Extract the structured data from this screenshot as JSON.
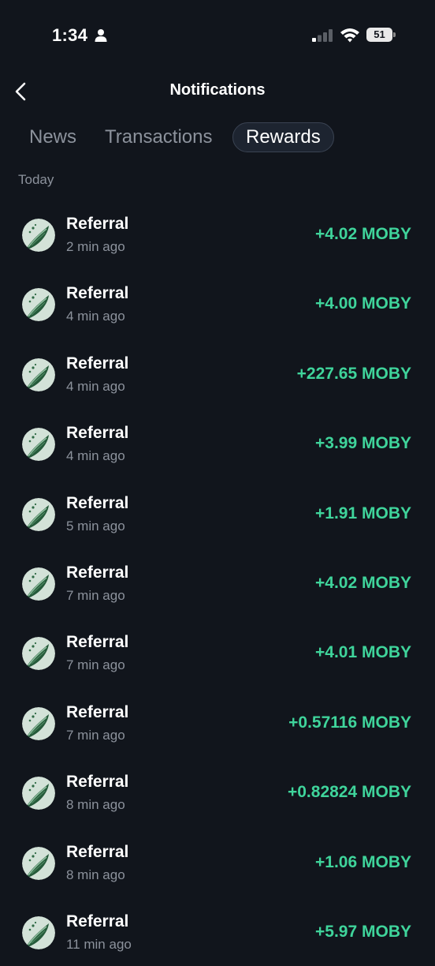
{
  "status_bar": {
    "time": "1:34",
    "battery": "51"
  },
  "header": {
    "title": "Notifications"
  },
  "tabs": [
    {
      "label": "News",
      "selected": false
    },
    {
      "label": "Transactions",
      "selected": false
    },
    {
      "label": "Rewards",
      "selected": true
    }
  ],
  "section": {
    "label": "Today"
  },
  "rewards": [
    {
      "title": "Referral",
      "time": "2 min ago",
      "amount": "+4.02 MOBY"
    },
    {
      "title": "Referral",
      "time": "4 min ago",
      "amount": "+4.00 MOBY"
    },
    {
      "title": "Referral",
      "time": "4 min ago",
      "amount": "+227.65 MOBY"
    },
    {
      "title": "Referral",
      "time": "4 min ago",
      "amount": "+3.99 MOBY"
    },
    {
      "title": "Referral",
      "time": "5 min ago",
      "amount": "+1.91 MOBY"
    },
    {
      "title": "Referral",
      "time": "7 min ago",
      "amount": "+4.02 MOBY"
    },
    {
      "title": "Referral",
      "time": "7 min ago",
      "amount": "+4.01 MOBY"
    },
    {
      "title": "Referral",
      "time": "7 min ago",
      "amount": "+0.57116 MOBY"
    },
    {
      "title": "Referral",
      "time": "8 min ago",
      "amount": "+0.82824 MOBY"
    },
    {
      "title": "Referral",
      "time": "8 min ago",
      "amount": "+1.06 MOBY"
    },
    {
      "title": "Referral",
      "time": "11 min ago",
      "amount": "+5.97 MOBY"
    }
  ],
  "icons": {
    "back": "chevron-left-icon",
    "avatar": "moby-whale-avatar-icon",
    "person": "person-icon",
    "signal": "cellular-signal-icon",
    "wifi": "wifi-icon"
  },
  "colors": {
    "background": "#11151c",
    "accent_positive": "#3fd49b",
    "muted_text": "#8c929c",
    "tab_selected_bg": "#1d2430"
  }
}
